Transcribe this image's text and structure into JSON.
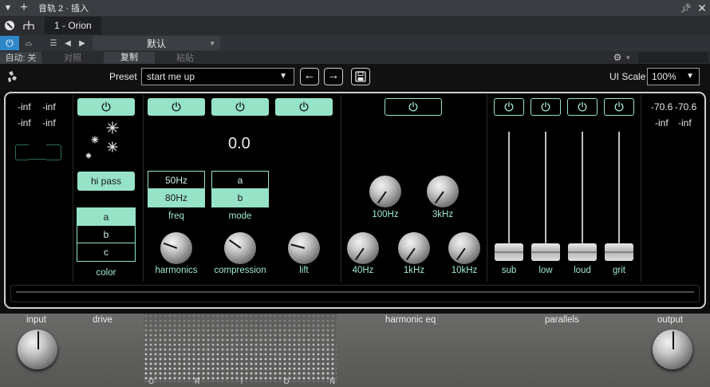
{
  "window": {
    "title": "音轨 2 · 插入",
    "device_name": "1 - Orion"
  },
  "host": {
    "preset_name": "默认",
    "auto_label": "自动: 关",
    "compare_label": "对照",
    "copy_label": "复制",
    "paste_label": "粘贴"
  },
  "plugin": {
    "preset_label": "Preset",
    "preset_value": "start me up",
    "ui_scale_label": "UI Scale",
    "ui_scale_value": "100%",
    "input_meter": {
      "row1": [
        "-inf",
        "-inf"
      ],
      "row2": [
        "-inf",
        "-inf"
      ]
    },
    "output_meter": {
      "row1": [
        "-70.6",
        "-70.6"
      ],
      "row2": [
        "-inf",
        "-inf"
      ]
    },
    "color": {
      "power_on": true,
      "filter_button": "hi pass",
      "options": [
        "a",
        "b",
        "c"
      ],
      "selected": "a",
      "label": "color"
    },
    "drive": {
      "power_on": [
        true,
        true,
        true
      ],
      "value": "0.0",
      "freq_options": [
        "50Hz",
        "80Hz"
      ],
      "freq_selected": "80Hz",
      "freq_label": "freq",
      "mode_options": [
        "a",
        "b"
      ],
      "mode_selected": "b",
      "mode_label": "mode",
      "knobs": [
        {
          "label": "harmonics",
          "angle": 110
        },
        {
          "label": "compression",
          "angle": 125
        },
        {
          "label": "lift",
          "angle": 105
        }
      ]
    },
    "eq": {
      "power_on": false,
      "knobs_top": [
        {
          "label": "100Hz",
          "angle": 35
        },
        {
          "label": "3kHz",
          "angle": 35
        }
      ],
      "knobs_bottom": [
        {
          "label": "40Hz",
          "angle": 35
        },
        {
          "label": "1kHz",
          "angle": 35
        },
        {
          "label": "10kHz",
          "angle": 35
        }
      ]
    },
    "parallels": {
      "faders": [
        {
          "label": "sub",
          "level": 0.0,
          "power_on": false
        },
        {
          "label": "low",
          "level": 0.0,
          "power_on": false
        },
        {
          "label": "loud",
          "level": 0.0,
          "power_on": false
        },
        {
          "label": "grit",
          "level": 0.0,
          "power_on": false
        }
      ]
    },
    "sections": {
      "input": "input",
      "drive": "drive",
      "harmonic_eq": "harmonic eq",
      "parallels": "parallels",
      "output": "output"
    },
    "io_knobs": {
      "input_angle": 180,
      "output_angle": 180
    },
    "brand_letters": [
      "O",
      "R",
      "I",
      "O",
      "N"
    ]
  }
}
